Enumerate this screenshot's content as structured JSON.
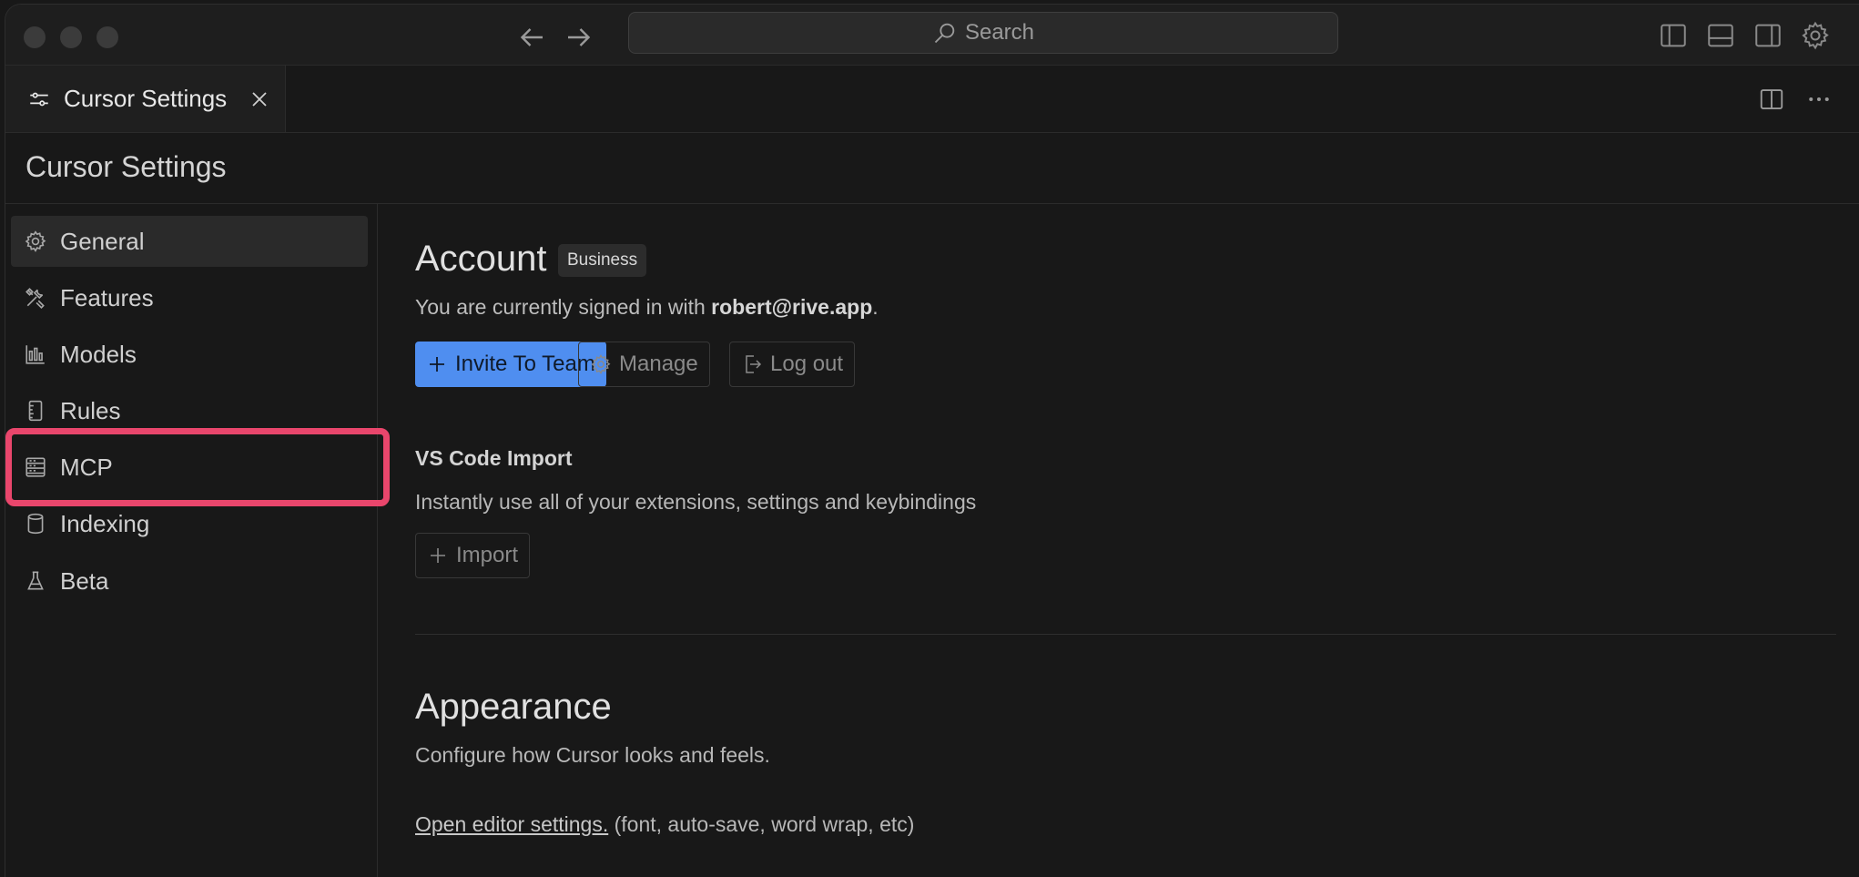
{
  "titlebar": {
    "search_label": "Search"
  },
  "tab": {
    "label": "Cursor Settings"
  },
  "settings": {
    "title": "Cursor Settings"
  },
  "sidebar": {
    "items": [
      {
        "label": "General",
        "icon": "gear-icon",
        "active": true
      },
      {
        "label": "Features",
        "icon": "tools-icon"
      },
      {
        "label": "Models",
        "icon": "bar-chart-icon"
      },
      {
        "label": "Rules",
        "icon": "ruler-icon"
      },
      {
        "label": "MCP",
        "icon": "server-icon",
        "highlighted": true
      },
      {
        "label": "Indexing",
        "icon": "database-icon"
      },
      {
        "label": "Beta",
        "icon": "flask-icon"
      }
    ]
  },
  "account": {
    "title": "Account",
    "badge": "Business",
    "signed_prefix": "You are currently signed in with ",
    "email": "robert@rive.app",
    "signed_suffix": ".",
    "invite_label": "Invite To Team",
    "manage_label": "Manage",
    "logout_label": "Log out"
  },
  "vscode_import": {
    "title": "VS Code Import",
    "description": "Instantly use all of your extensions, settings and keybindings",
    "import_label": "Import"
  },
  "appearance": {
    "title": "Appearance",
    "description": "Configure how Cursor looks and feels.",
    "link_label": "Open editor settings.",
    "link_suffix": " (font, auto-save, word wrap, etc)"
  },
  "colors": {
    "accent": "#4f8ef0",
    "highlight": "#e9466c",
    "background": "#181818"
  }
}
